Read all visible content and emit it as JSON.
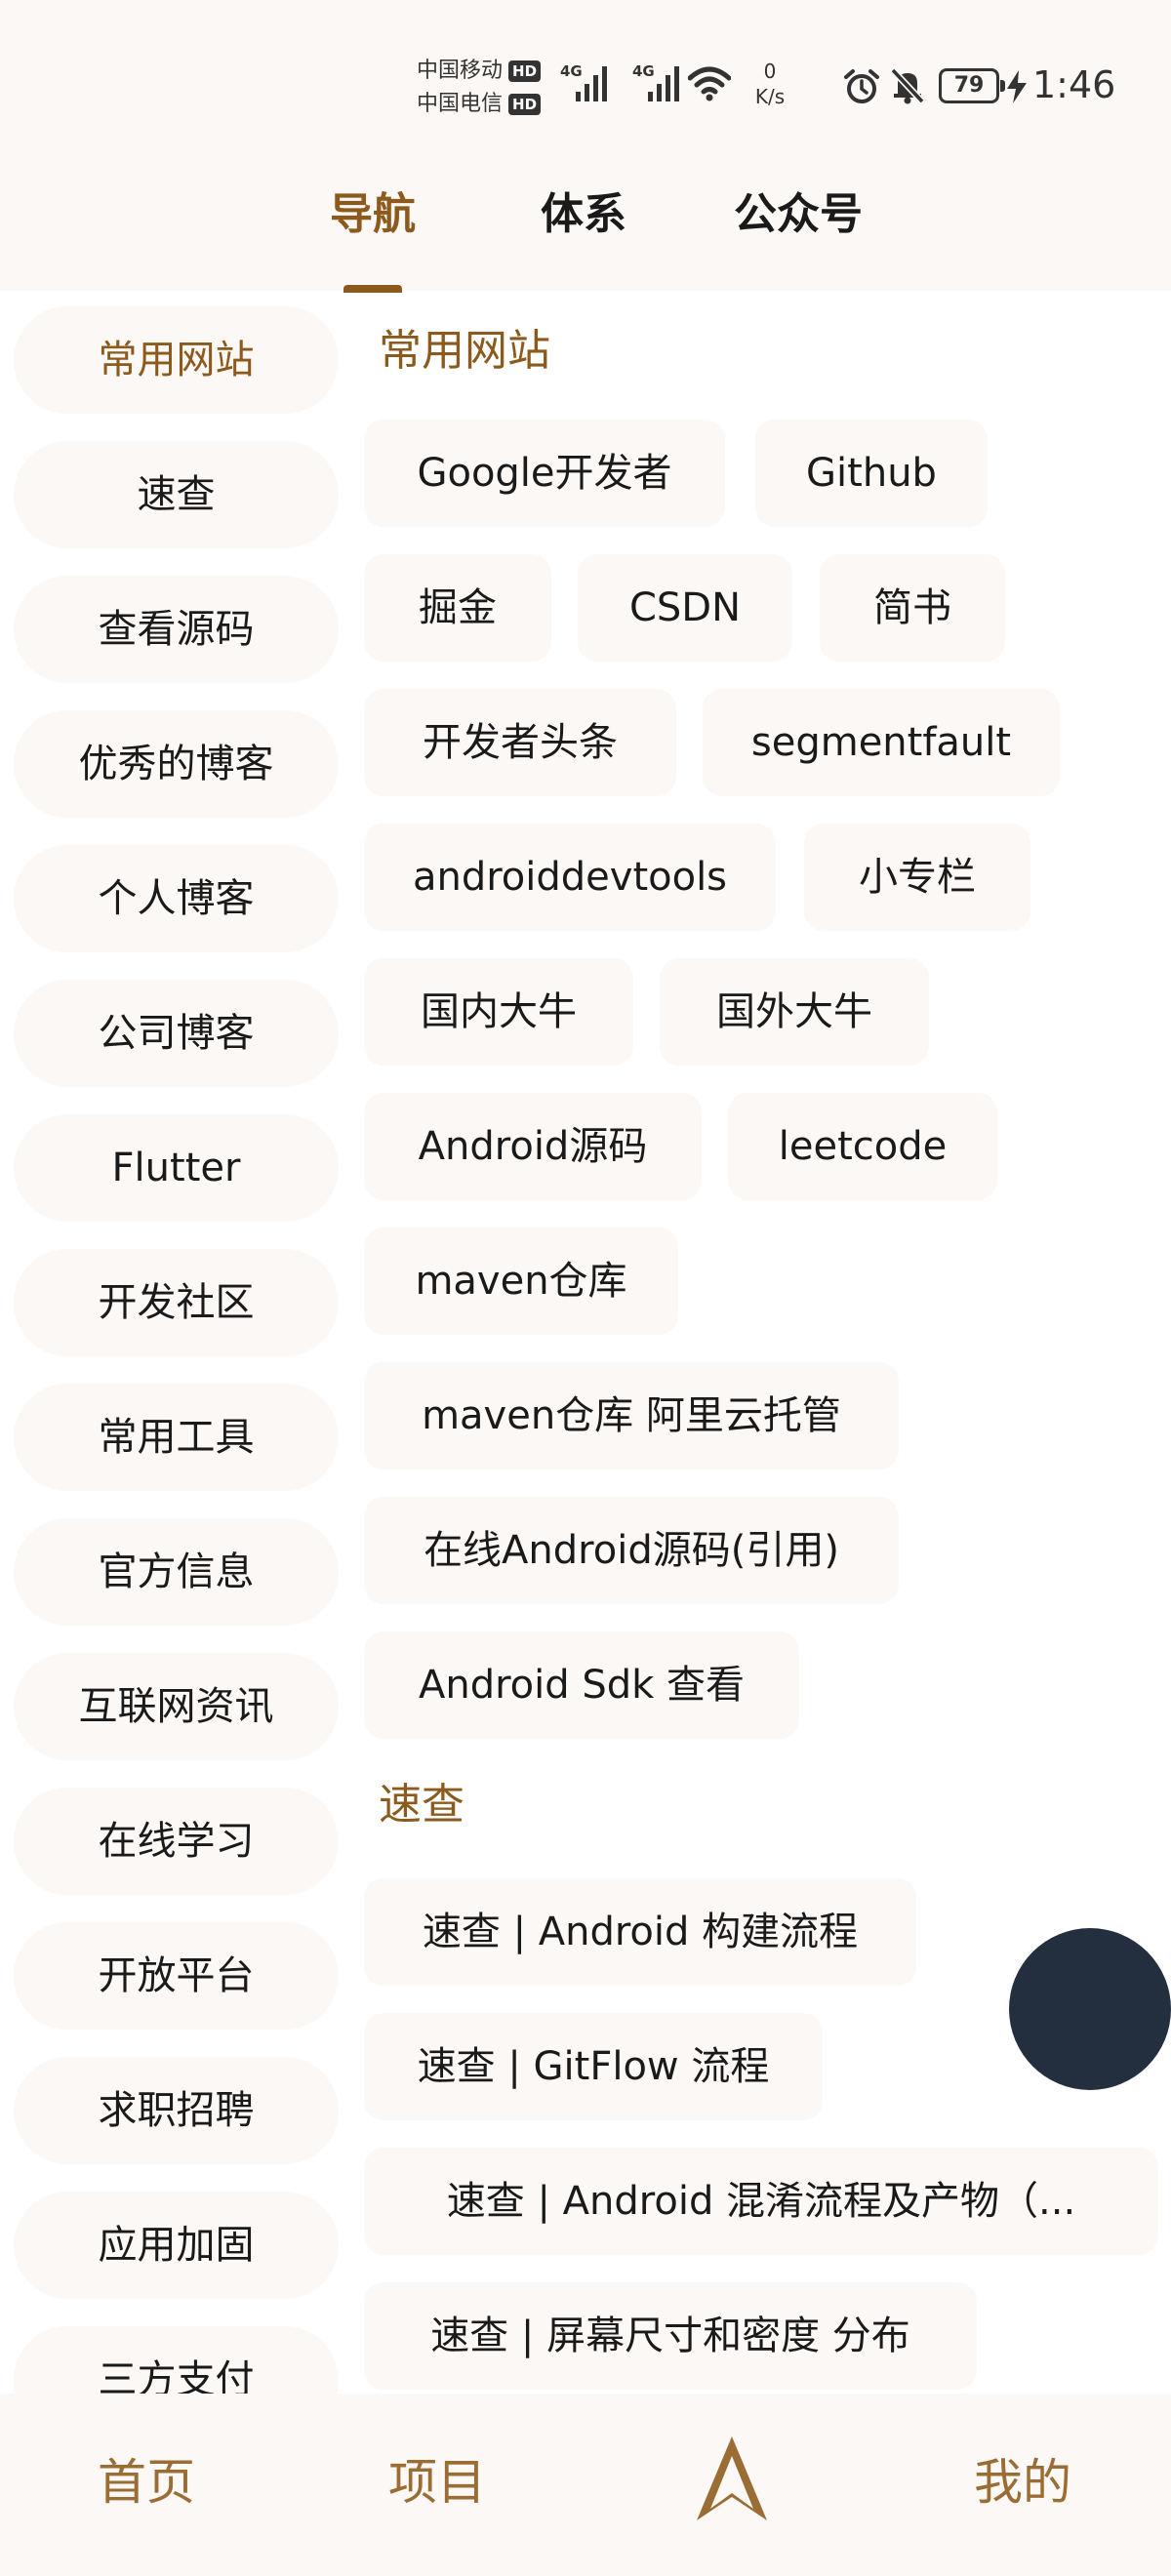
{
  "status_bar": {
    "carrier1": "中国移动",
    "carrier2": "中国电信",
    "hd": "HD",
    "network_type": "4G",
    "speed_value": "0",
    "speed_unit": "K/s",
    "battery": "79",
    "time": "1:46",
    "icons": [
      "signal-icon",
      "wifi-icon",
      "alarm-icon",
      "bell-muted-icon",
      "battery-icon",
      "charging-bolt-icon"
    ]
  },
  "top_tabs": [
    {
      "label": "导航",
      "active": true
    },
    {
      "label": "体系",
      "active": false
    },
    {
      "label": "公众号",
      "active": false
    }
  ],
  "categories": [
    {
      "label": "常用网站",
      "active": true
    },
    {
      "label": "速查"
    },
    {
      "label": "查看源码"
    },
    {
      "label": "优秀的博客"
    },
    {
      "label": "个人博客"
    },
    {
      "label": "公司博客"
    },
    {
      "label": "Flutter"
    },
    {
      "label": "开发社区"
    },
    {
      "label": "常用工具"
    },
    {
      "label": "官方信息"
    },
    {
      "label": "互联网资讯"
    },
    {
      "label": "在线学习"
    },
    {
      "label": "开放平台"
    },
    {
      "label": "求职招聘"
    },
    {
      "label": "应用加固"
    },
    {
      "label": "三方支付"
    }
  ],
  "sections": [
    {
      "title": "常用网站",
      "chips": [
        "Google开发者",
        "Github",
        "掘金",
        "CSDN",
        "简书",
        "开发者头条",
        "segmentfault",
        "androiddevtools",
        "小专栏",
        "国内大牛",
        "国外大牛",
        "Android源码",
        "leetcode",
        "maven仓库",
        "maven仓库 阿里云托管",
        "在线Android源码(引用)",
        "Android Sdk 查看"
      ]
    },
    {
      "title": "速查",
      "chips": [
        "速查 | Android 构建流程",
        "速查 | GitFlow 流程",
        "速查 | Android 混淆流程及产物（...",
        "速查 | 屏幕尺寸和密度 分布"
      ]
    }
  ],
  "bottom_nav": {
    "items": [
      "首页",
      "项目",
      "我的"
    ],
    "center_icon": "navigation-arrow-icon"
  },
  "colors": {
    "accent": "#8b5a1c",
    "nav_text": "#9a6d35",
    "cream": "#fcf8f5",
    "fab": "#232f3e"
  }
}
